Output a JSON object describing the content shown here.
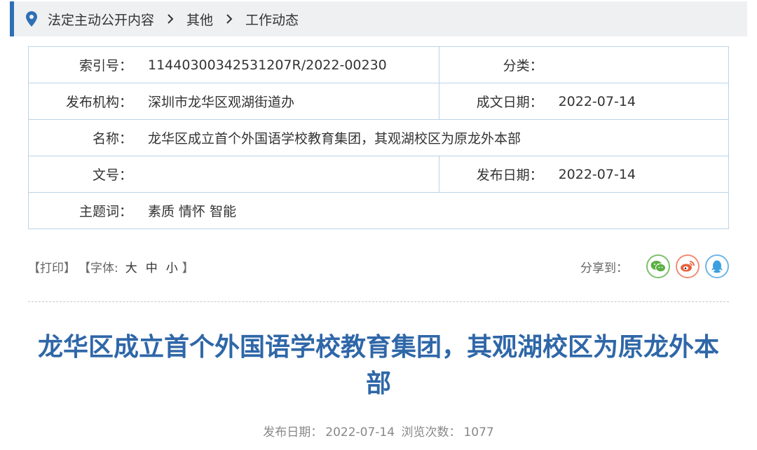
{
  "breadcrumb": {
    "items": [
      "法定主动公开内容",
      "其他",
      "工作动态"
    ]
  },
  "info": {
    "index_label": "索引号：",
    "index_value": "11440300342531207R/2022-00230",
    "category_label": "分类：",
    "category_value": "",
    "issuer_label": "发布机构：",
    "issuer_value": "深圳市龙华区观湖街道办",
    "created_label": "成文日期：",
    "created_value": "2022-07-14",
    "name_label": "名称：",
    "name_value": "龙华区成立首个外国语学校教育集团，其观湖校区为原龙外本部",
    "docno_label": "文号：",
    "docno_value": "",
    "published_label": "发布日期：",
    "published_value": "2022-07-14",
    "keywords_label": "主题词：",
    "keywords_value": "素质 情怀 智能"
  },
  "tools": {
    "print": "打印",
    "font_label": "字体:",
    "font_large": "大",
    "font_medium": "中",
    "font_small": "小",
    "share_label": "分享到："
  },
  "article": {
    "title": "龙华区成立首个外国语学校教育集团，其观湖校区为原龙外本部",
    "meta_date_label": "发布日期：",
    "meta_date": "2022-07-14",
    "meta_views_label": "浏览次数：",
    "meta_views": "1077"
  },
  "colors": {
    "accent": "#2f6fb5",
    "title": "#2f67a8",
    "table_border": "#bcd3e6",
    "wechat": "#5cb043",
    "weibo": "#e8603c",
    "qq": "#3c9fe0"
  },
  "icons": {
    "location": "location-pin-icon",
    "separator": "chevron-right-icon",
    "wechat": "wechat-icon",
    "weibo": "weibo-icon",
    "qq": "qq-icon"
  }
}
